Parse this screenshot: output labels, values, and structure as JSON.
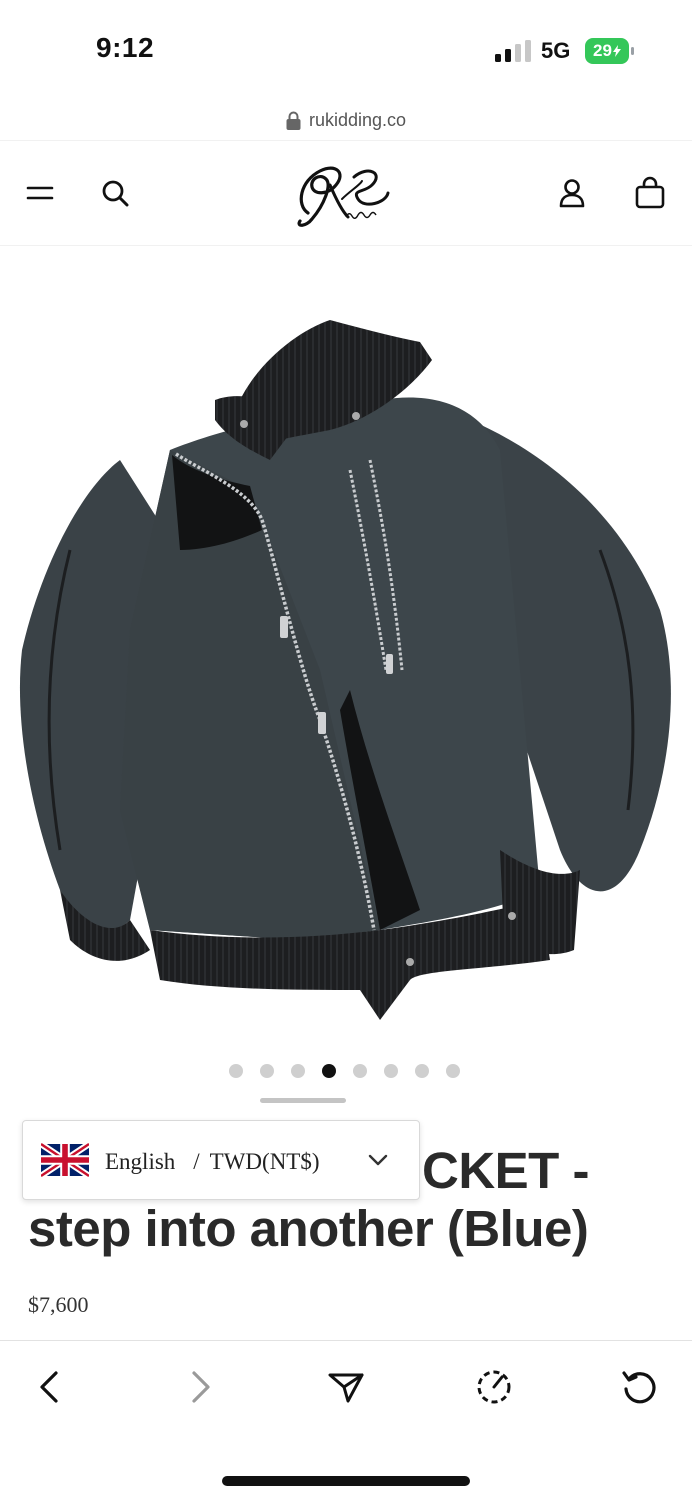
{
  "status_bar": {
    "time": "9:12",
    "network": "5G",
    "battery": "29"
  },
  "url_bar": {
    "domain": "rukidding.co"
  },
  "header": {
    "logo_text": "RK",
    "logo_script": "Kiddins",
    "icons": [
      "menu-icon",
      "search-icon",
      "account-icon",
      "cart-icon"
    ]
  },
  "carousel": {
    "total": 8,
    "active_index": 3
  },
  "product": {
    "title_line1": "CKET -",
    "title_line2": "step into another (Blue)",
    "price": "$7,600"
  },
  "locale_selector": {
    "language": "English",
    "separator": "/",
    "currency": "TWD(NT$)"
  },
  "toolbar": {
    "buttons": [
      "back",
      "forward",
      "share",
      "speed",
      "reload"
    ]
  },
  "colors": {
    "battery": "#34c759",
    "jacket_body": "#3a4247",
    "jacket_knit": "#1c1d1f",
    "dot_active": "#111111",
    "dot_inactive": "#cfcfcf"
  }
}
